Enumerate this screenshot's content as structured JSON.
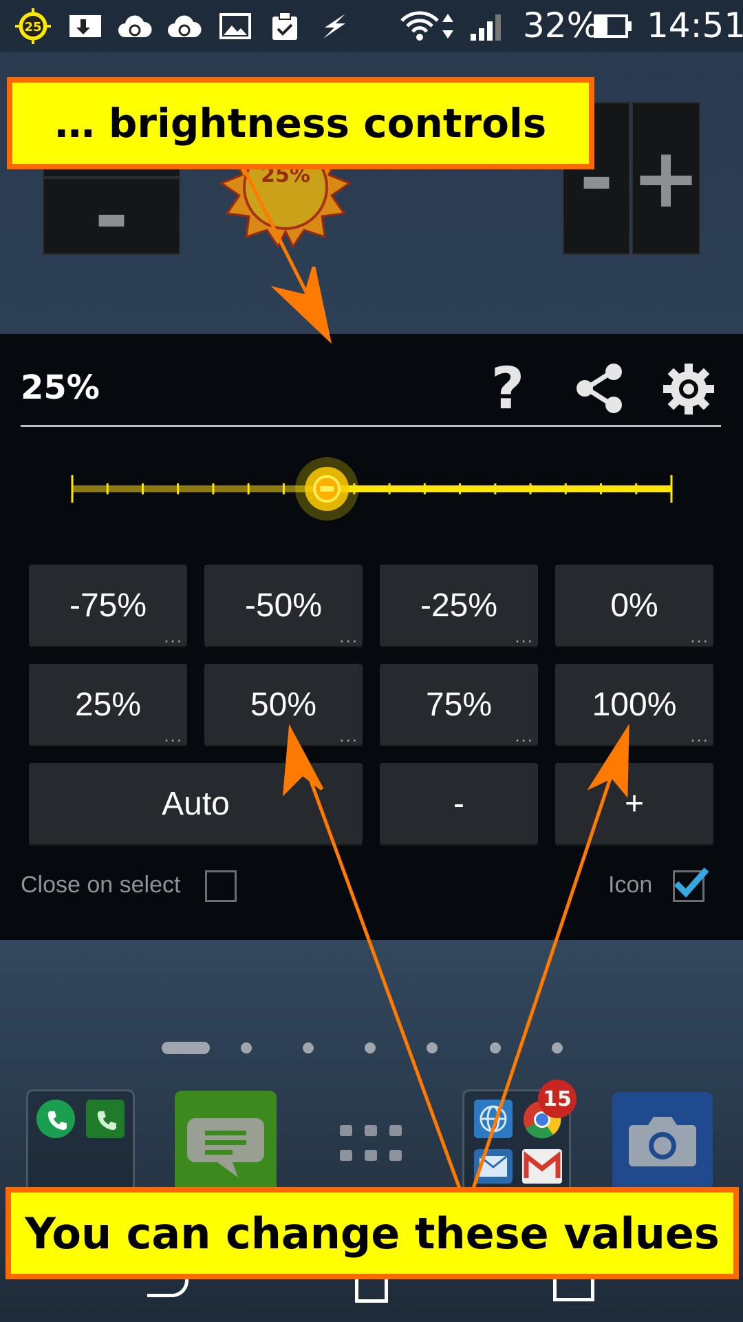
{
  "status_bar": {
    "badge_number": "25",
    "battery": "32%",
    "time": "14:51",
    "icons": [
      "brightness-badge-icon",
      "download-icon",
      "sync-cloud-icon",
      "sync-cloud-icon",
      "image-icon",
      "clipboard-check-icon",
      "lightning-icon",
      "wifi-icon",
      "signal-icon",
      "battery-icon"
    ]
  },
  "widget": {
    "minus_label": "-",
    "plus_label": "+",
    "minus2_label": "-",
    "sun_value": "25%"
  },
  "panel": {
    "title": "25%",
    "help_icon": "?",
    "slider_value": 25,
    "buttons_row1": [
      "-75%",
      "-50%",
      "-25%",
      "0%"
    ],
    "buttons_row2": [
      "25%",
      "50%",
      "75%",
      "100%"
    ],
    "auto_label": "Auto",
    "minus_label": "-",
    "plus_label": "+",
    "more_indicator": "...",
    "close_on_select_label": "Close on select",
    "close_on_select_checked": false,
    "icon_label": "Icon",
    "icon_checked": true
  },
  "dock": {
    "chrome_badge": "15"
  },
  "annotations": {
    "top": "… brightness controls",
    "bottom": "You can change these values"
  },
  "colors": {
    "accent_orange": "#ff6a00",
    "callout_yellow": "#ffff00",
    "slider_yellow": "#ffe600",
    "check_blue": "#35a8e0"
  }
}
